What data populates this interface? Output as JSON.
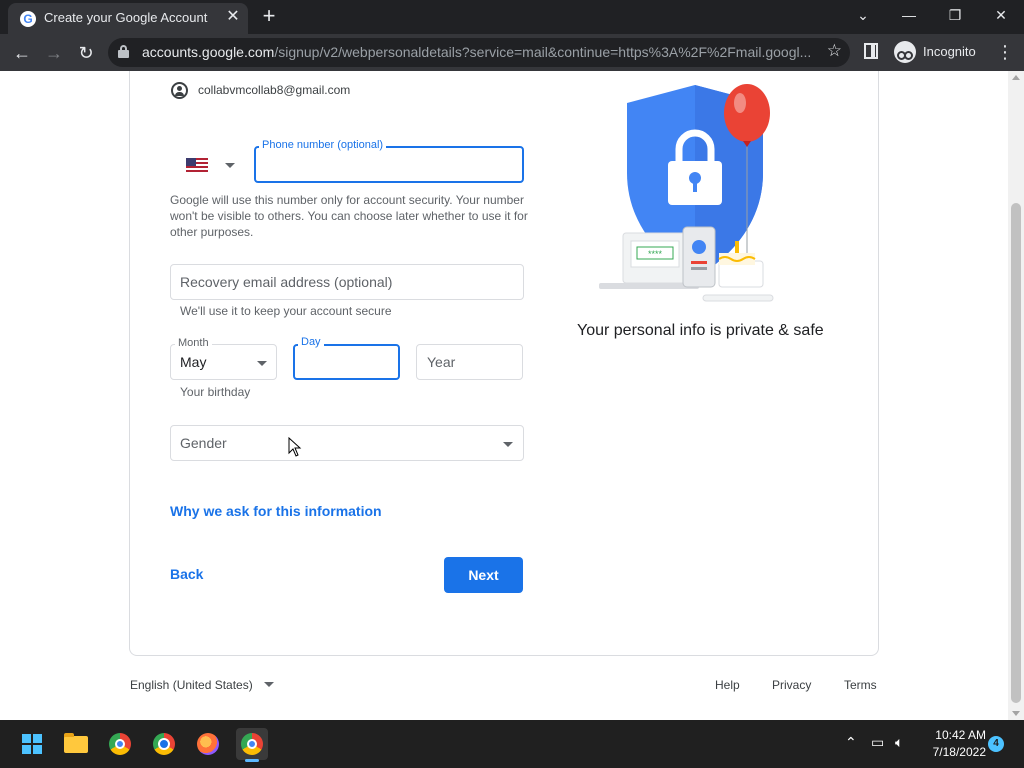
{
  "browser": {
    "tab_title": "Create your Google Account",
    "favicon_letter": "G",
    "tab_close": "✕",
    "new_tab": "+",
    "url_host": "accounts.google.com",
    "url_path": "/signup/v2/webpersonaldetails?service=mail&continue=https%3A%2F%2Fmail.googl...",
    "incognito_label": "Incognito"
  },
  "form": {
    "account_email": "collabvmcollab8@gmail.com",
    "country_flag": "us-flag-icon",
    "phone": {
      "label": "Phone number (optional)",
      "value": ""
    },
    "phone_helper": "Google will use this number only for account security. Your number won't be visible to others. You can choose later whether to use it for other purposes.",
    "recovery_email": {
      "placeholder": "Recovery email address (optional)",
      "value": ""
    },
    "recovery_helper": "We'll use it to keep your account secure",
    "birthday": {
      "month_label": "Month",
      "month_value": "May",
      "day_label": "Day",
      "day_value": "",
      "year_placeholder": "Year",
      "helper": "Your birthday"
    },
    "gender": {
      "placeholder": "Gender"
    },
    "why_link": "Why we ask for this information",
    "back_button": "Back",
    "next_button": "Next"
  },
  "illustration": {
    "pin_mask": "****",
    "caption": "Your personal info is private & safe"
  },
  "footer": {
    "language": "English (United States)",
    "help": "Help",
    "privacy": "Privacy",
    "terms": "Terms"
  },
  "taskbar": {
    "time": "10:42 AM",
    "date": "7/18/2022",
    "notification_count": "4"
  },
  "colors": {
    "accent": "#1a73e8",
    "shield": "#4285f4",
    "balloon": "#ea4335"
  }
}
